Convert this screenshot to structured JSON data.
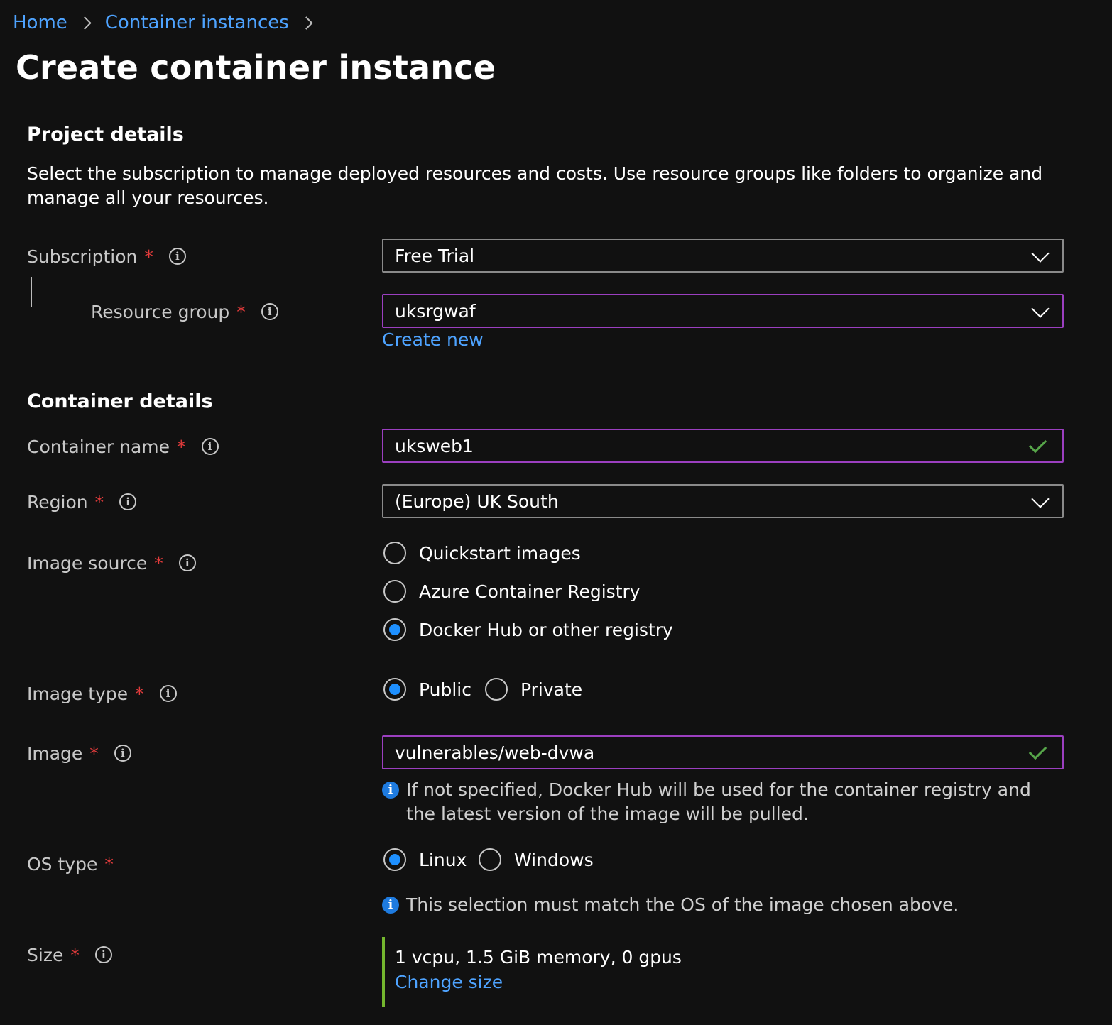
{
  "breadcrumb": {
    "home": "Home",
    "container_instances": "Container instances"
  },
  "page": {
    "title": "Create container instance"
  },
  "project_details": {
    "title": "Project details",
    "description": "Select the subscription to manage deployed resources and costs. Use resource groups like folders to organize and manage all your resources.",
    "subscription": {
      "label": "Subscription",
      "required": "*",
      "value": "Free Trial"
    },
    "resource_group": {
      "label": "Resource group",
      "required": "*",
      "value": "uksrgwaf",
      "create_new": "Create new"
    }
  },
  "container_details": {
    "title": "Container details",
    "container_name": {
      "label": "Container name",
      "required": "*",
      "value": "uksweb1"
    },
    "region": {
      "label": "Region",
      "required": "*",
      "value": "(Europe) UK South"
    },
    "image_source": {
      "label": "Image source",
      "required": "*",
      "options": [
        "Quickstart images",
        "Azure Container Registry",
        "Docker Hub or other registry"
      ],
      "selected": "Docker Hub or other registry"
    },
    "image_type": {
      "label": "Image type",
      "required": "*",
      "options": [
        "Public",
        "Private"
      ],
      "selected": "Public"
    },
    "image": {
      "label": "Image",
      "required": "*",
      "value": "vulnerables/web-dvwa",
      "note": "If not specified, Docker Hub will be used for the container registry and the latest version of the image will be pulled."
    },
    "os_type": {
      "label": "OS type",
      "required": "*",
      "options": [
        "Linux",
        "Windows"
      ],
      "selected": "Linux",
      "note": "This selection must match the OS of the image chosen above."
    },
    "size": {
      "label": "Size",
      "required": "*",
      "value": "1 vcpu, 1.5 GiB memory, 0 gpus",
      "change": "Change size"
    }
  },
  "icons": {
    "info": "i"
  },
  "colors": {
    "background": "#111111",
    "link": "#4ea3ff",
    "active_border": "#9b3fc0",
    "radio_selected": "#1e90ff",
    "required": "#e03b3b",
    "valid": "#57a64a",
    "size_accent": "#74b72e"
  }
}
